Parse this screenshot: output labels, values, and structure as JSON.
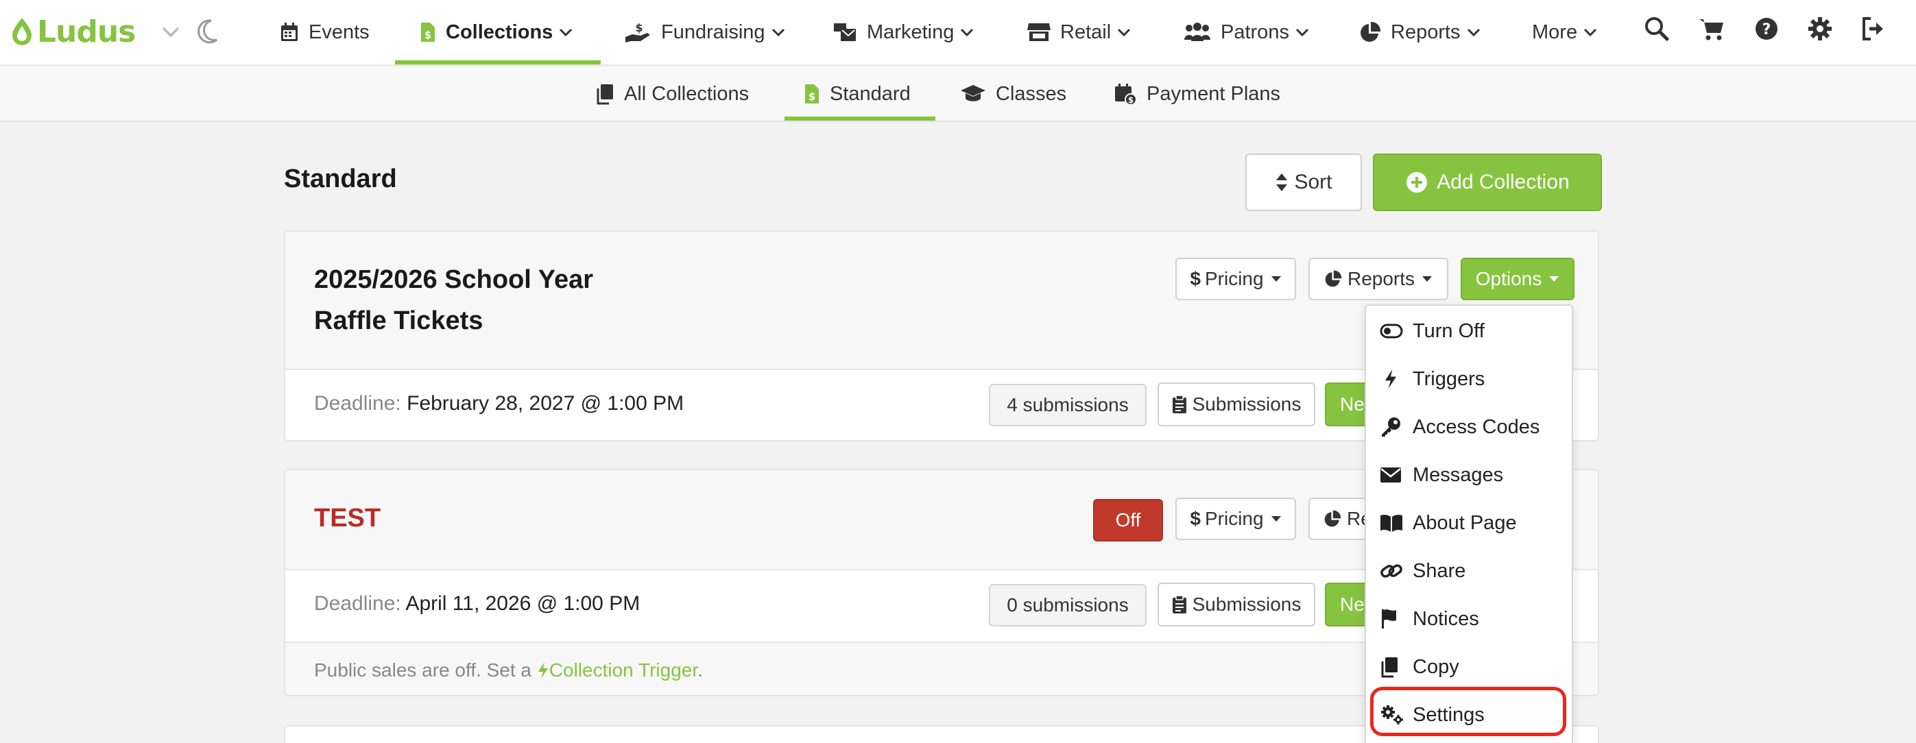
{
  "brand": {
    "name": "Ludus",
    "accent": "#86c440"
  },
  "topnav": {
    "items": [
      {
        "label": "Events",
        "icon": "calendar-icon"
      },
      {
        "label": "Collections",
        "icon": "money-doc-icon",
        "active": true
      },
      {
        "label": "Fundraising",
        "icon": "hand-dollar-icon"
      },
      {
        "label": "Marketing",
        "icon": "mail-bulk-icon"
      },
      {
        "label": "Retail",
        "icon": "store-icon"
      },
      {
        "label": "Patrons",
        "icon": "users-icon"
      },
      {
        "label": "Reports",
        "icon": "pie-chart-icon"
      },
      {
        "label": "More",
        "icon": "chevron-down-icon"
      }
    ],
    "right_icons": [
      "search-icon",
      "cart-icon",
      "help-icon",
      "gear-icon",
      "sign-out-icon"
    ]
  },
  "subnav": {
    "items": [
      {
        "label": "All Collections",
        "icon": "copy-icon"
      },
      {
        "label": "Standard",
        "icon": "money-doc-icon",
        "active": true
      },
      {
        "label": "Classes",
        "icon": "graduation-cap-icon"
      },
      {
        "label": "Payment Plans",
        "icon": "calendar-dollar-icon"
      }
    ]
  },
  "page": {
    "title": "Standard",
    "sort_label": "Sort",
    "add_label": "Add Collection"
  },
  "cards": [
    {
      "title_line1": "2025/2026 School Year",
      "title_line2": "Raffle Tickets",
      "pricing_label": "Pricing",
      "reports_label": "Reports",
      "options_label": "Options",
      "deadline_label": "Deadline:",
      "deadline_value": "February 28, 2027 @ 1:00 PM",
      "count": "4 submissions",
      "submissions_label": "Submissions",
      "new_label": "Ne"
    },
    {
      "title": "TEST",
      "off_label": "Off",
      "pricing_label": "Pricing",
      "reports_label": "Re",
      "deadline_label": "Deadline:",
      "deadline_value": "April 11, 2026 @ 1:00 PM",
      "count": "0 submissions",
      "submissions_label": "Submissions",
      "new_label": "Ne",
      "notice_text": "Public sales are off. Set a",
      "notice_link": "Collection Trigger",
      "notice_end": "."
    }
  ],
  "options_menu": [
    {
      "label": "Turn Off",
      "icon": "toggle-icon"
    },
    {
      "label": "Triggers",
      "icon": "bolt-icon"
    },
    {
      "label": "Access Codes",
      "icon": "key-icon"
    },
    {
      "label": "Messages",
      "icon": "envelope-icon"
    },
    {
      "label": "About Page",
      "icon": "book-open-icon"
    },
    {
      "label": "Share",
      "icon": "link-icon"
    },
    {
      "label": "Notices",
      "icon": "flag-icon"
    },
    {
      "label": "Copy",
      "icon": "copy-icon"
    },
    {
      "label": "Settings",
      "icon": "gears-icon",
      "highlighted": true
    }
  ],
  "colors": {
    "highlight": "#e8281e",
    "off": "#c0392b",
    "title_red": "#b82d25"
  }
}
